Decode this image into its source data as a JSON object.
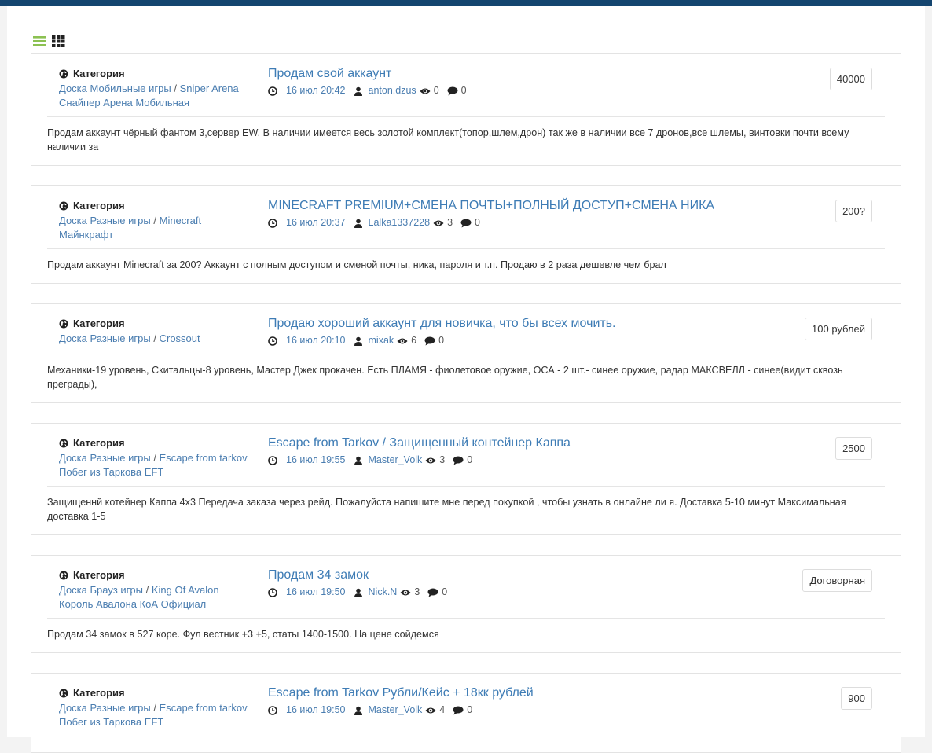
{
  "view_toggle": {
    "list_icon": "list-icon",
    "grid_icon": "grid-icon",
    "active": "list"
  },
  "colors": {
    "topbar": "#14456f",
    "link": "#3e7cb5",
    "list_icon": "#8cc152"
  },
  "listings": [
    {
      "category_label": "Категория",
      "category_parent": "Доска Мобильные игры",
      "category_child": "Sniper Arena Снайпер Арена Мобильная",
      "title": "Продам свой аккаунт",
      "date": "16 июл 20:42",
      "author": "anton.dzus",
      "views": "0",
      "comments": "0",
      "price": "40000",
      "description": "Продам аккаунт чёрный фантом 3,сервер EW. В наличии имеется весь золотой комплект(топор,шлем,дрон) так же в наличии все 7 дронов,все шлемы, винтовки почти всему наличии за"
    },
    {
      "category_label": "Категория",
      "category_parent": "Доска Разные игры",
      "category_child": "Minecraft Майнкрафт",
      "title": "MINECRAFT PREMIUM+СМЕНА ПОЧТЫ+ПОЛНЫЙ ДОСТУП+СМЕНА НИКА",
      "date": "16 июл 20:37",
      "author": "Lalka1337228",
      "views": "3",
      "comments": "0",
      "price": "200?",
      "description": "Продам аккаунт Minecraft за 200? Аккаунт с полным доступом и сменой почты, ника, пароля и т.п. Продаю в 2 раза дешевле чем брал"
    },
    {
      "category_label": "Категория",
      "category_parent": "Доска Разные игры",
      "category_child": "Crossout",
      "title": "Продаю хороший аккаунт для новичка, что бы всех мочить.",
      "date": "16 июл 20:10",
      "author": "mixak",
      "views": "6",
      "comments": "0",
      "price": "100 рублей",
      "description": "Механики-19 уровень, Скитальцы-8 уровень, Мастер Джек прокачен. Есть ПЛАМЯ - фиолетовое оружие, ОСА - 2 шт.- синее оружие, радар МАКСВЕЛЛ - синее(видит сквозь преграды),"
    },
    {
      "category_label": "Категория",
      "category_parent": "Доска Разные игры",
      "category_child": "Escape from tarkov Побег из Таркова EFT",
      "title": "Escape from Tarkov / Защищенный контейнер Каппа",
      "date": "16 июл 19:55",
      "author": "Master_Volk",
      "views": "3",
      "comments": "0",
      "price": "2500",
      "description": "Защищеннй котейнер Каппа 4x3 Передача заказа через рейд. Пожалуйста напишите мне перед покупкой , чтобы узнать в онлайне ли я. Доставка 5-10 минут Максимальная доставка 1-5"
    },
    {
      "category_label": "Категория",
      "category_parent": "Доска Брауз игры",
      "category_child": "King Of Avalon Король Авалона КоА Официал",
      "title": "Продам 34 замок",
      "date": "16 июл 19:50",
      "author": "Nick.N",
      "views": "3",
      "comments": "0",
      "price": "Договорная",
      "description": "Продам 34 замок в 527 коре. Фул вестник +3 +5, статы 1400-1500. На цене сойдемся"
    },
    {
      "category_label": "Категория",
      "category_parent": "Доска Разные игры",
      "category_child": "Escape from tarkov Побег из Таркова EFT",
      "title": "Escape from Tarkov Рубли/Кейс + 18кк рублей",
      "date": "16 июл 19:50",
      "author": "Master_Volk",
      "views": "4",
      "comments": "0",
      "price": "900",
      "description": ""
    }
  ]
}
